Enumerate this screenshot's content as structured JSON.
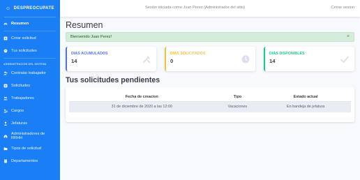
{
  "sidebar": {
    "brand": "DESPREOCUPATE",
    "brand_icon": "sun-face-icon",
    "nav_top": [
      {
        "label": "Resumen",
        "icon": "tachometer-icon",
        "active": true
      },
      {
        "label": "Crear solicitud",
        "icon": "plus-square-icon"
      },
      {
        "label": "Tus solicitudes",
        "icon": "clock-icon"
      }
    ],
    "admin_heading": "ADMINISTRACION DEL SISTEMA",
    "nav_admin": [
      {
        "label": "Contratar trabajador",
        "icon": "user-plus-icon"
      },
      {
        "label": "Solicitudes",
        "icon": "list-icon"
      },
      {
        "label": "Trabajadores",
        "icon": "users-icon"
      },
      {
        "label": "Cargos",
        "icon": "users-cog-icon"
      },
      {
        "label": "Jefaturas",
        "icon": "user-tie-icon"
      },
      {
        "label": "Administradores de RRHH",
        "icon": "building-icon"
      },
      {
        "label": "Tipos de solicitud",
        "icon": "folder-icon"
      },
      {
        "label": "Departamentos",
        "icon": "building-alt-icon"
      }
    ]
  },
  "topbar": {
    "session_text": "Sesión iniciada como Juan Perez (Administrador del sitio)",
    "logout_label": "Cerrar sesion"
  },
  "main": {
    "title": "Resumen",
    "alert_text": "Bienvenido Juan Perez!",
    "alert_close": "×",
    "cards": [
      {
        "label": "DIAS ACUMULADOS",
        "value": "14",
        "color": "#4e73df",
        "icon": "tools-icon"
      },
      {
        "label": "DIAS SOLICITADOS",
        "value": "0",
        "color": "#f6c23e",
        "icon": "clock-icon"
      },
      {
        "label": "DIAS DISPONIBLES",
        "value": "14",
        "color": "#1cc88a",
        "icon": "check-icon"
      }
    ],
    "pending_title": "Tus solicitudes pendientes",
    "table": {
      "headers": [
        "Fecha de creacion",
        "Tipo",
        "Estado actual"
      ],
      "rows": [
        [
          "31 de diciembre de 2020 a las 12:00",
          "Vacaciones",
          "En bandeja de jefatura"
        ]
      ]
    }
  }
}
